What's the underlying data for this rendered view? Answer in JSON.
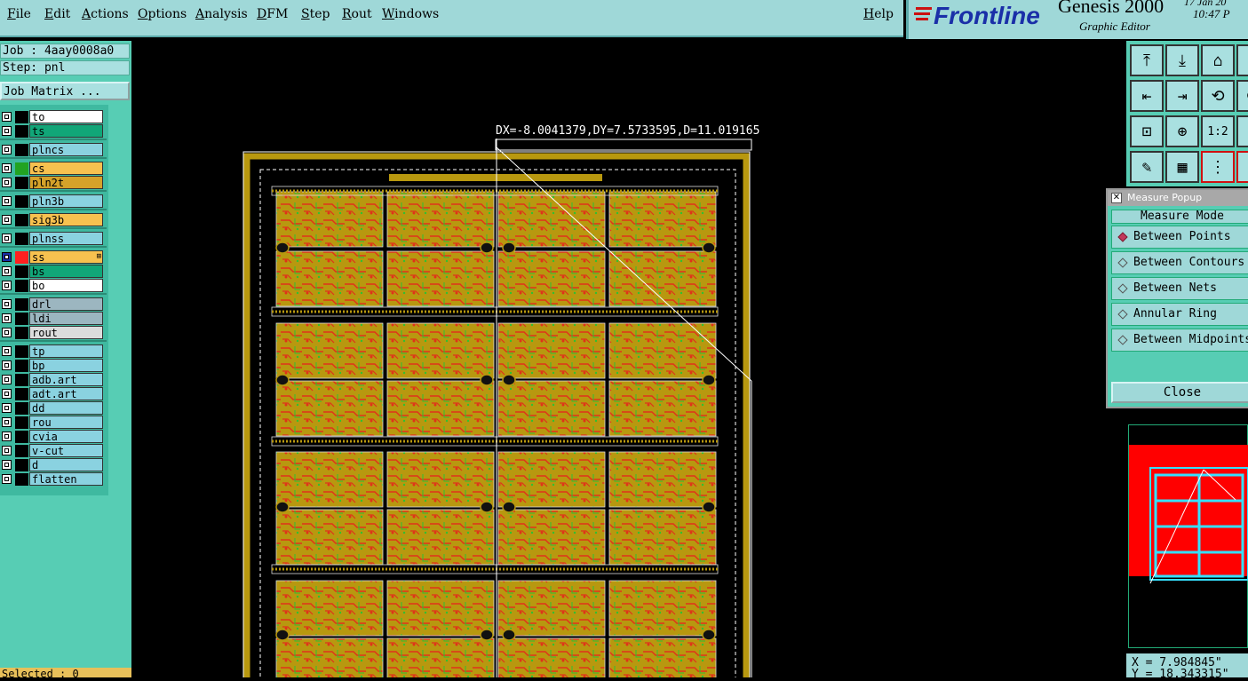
{
  "menu": {
    "items": [
      "File",
      "Edit",
      "Actions",
      "Options",
      "Analysis",
      "DFM",
      "Step",
      "Rout",
      "Windows"
    ],
    "help": "Help"
  },
  "brand": {
    "logo": "Frontline",
    "product": "Genesis 2000",
    "module": "Graphic Editor",
    "date": "17 Jan 20",
    "time": "10:47 P"
  },
  "job": {
    "job_label": "Job : 4aay0008a0",
    "step_label": "Step: pnl",
    "matrix_button": "Job Matrix ..."
  },
  "layers": [
    {
      "name": "to",
      "bg": "#ffffff",
      "swatch": "#000000"
    },
    {
      "name": "ts",
      "bg": "#11a678",
      "swatch": "#000000"
    },
    {
      "name": "plncs",
      "bg": "#8ad2e0",
      "swatch": "#000000"
    },
    {
      "name": "cs",
      "bg": "#f7c14f",
      "swatch": "#22a322"
    },
    {
      "name": "pln2t",
      "bg": "#d5a22a",
      "swatch": "#000000"
    },
    {
      "name": "pln3b",
      "bg": "#8ad2e0",
      "swatch": "#000000"
    },
    {
      "name": "sig3b",
      "bg": "#f7c14f",
      "swatch": "#000000"
    },
    {
      "name": "plnss",
      "bg": "#8ad2e0",
      "swatch": "#000000"
    },
    {
      "name": "ss",
      "bg": "#f7c14f",
      "swatch": "#ff2020",
      "active": true
    },
    {
      "name": "bs",
      "bg": "#11a678",
      "swatch": "#000000"
    },
    {
      "name": "bo",
      "bg": "#ffffff",
      "swatch": "#000000"
    },
    {
      "name": "drl",
      "bg": "#9cb6c0",
      "swatch": "#000000"
    },
    {
      "name": "ldi",
      "bg": "#9cb6c0",
      "swatch": "#000000"
    },
    {
      "name": "rout",
      "bg": "#dcdcdc",
      "swatch": "#000000"
    },
    {
      "name": "tp",
      "bg": "#8ad2e0",
      "swatch": "#000000"
    },
    {
      "name": "bp",
      "bg": "#8ad2e0",
      "swatch": "#000000"
    },
    {
      "name": "adb.art",
      "bg": "#8ad2e0",
      "swatch": "#000000"
    },
    {
      "name": "adt.art",
      "bg": "#8ad2e0",
      "swatch": "#000000"
    },
    {
      "name": "dd",
      "bg": "#8ad2e0",
      "swatch": "#000000"
    },
    {
      "name": "rou",
      "bg": "#8ad2e0",
      "swatch": "#000000"
    },
    {
      "name": "cvia",
      "bg": "#8ad2e0",
      "swatch": "#000000"
    },
    {
      "name": "v-cut",
      "bg": "#8ad2e0",
      "swatch": "#000000"
    },
    {
      "name": "d",
      "bg": "#8ad2e0",
      "swatch": "#000000"
    },
    {
      "name": "flatten",
      "bg": "#8ad2e0",
      "swatch": "#000000"
    }
  ],
  "selected_label": "Selected : 0",
  "measure_readout": "DX=-8.0041379,DY=7.5733595,D=11.019165",
  "tools": [
    {
      "icon": "home-top-icon"
    },
    {
      "icon": "home-bottom-icon"
    },
    {
      "icon": "house-icon"
    },
    {
      "icon": "side-icon"
    },
    {
      "icon": "pan-left-icon"
    },
    {
      "icon": "pan-right-icon"
    },
    {
      "icon": "step-left-icon"
    },
    {
      "icon": "step-right-icon"
    },
    {
      "icon": "zoom-fit-icon"
    },
    {
      "icon": "zoom-center-icon"
    },
    {
      "icon": "scale-icon",
      "label": "1:2"
    },
    {
      "icon": "panel-icon"
    },
    {
      "icon": "edit-tool-icon"
    },
    {
      "icon": "grid-icon"
    },
    {
      "icon": "net-icon"
    },
    {
      "icon": "net2-icon"
    }
  ],
  "popup": {
    "title": "Measure Popup",
    "heading": "Measure Mode",
    "options": [
      "Between Points",
      "Between Contours",
      "Between Nets",
      "Annular Ring",
      "Between Midpoints"
    ],
    "selected_index": 0,
    "close": "Close"
  },
  "coords": {
    "x": "X = 7.984845\"",
    "y": "Y = 18.343315\""
  },
  "colors": {
    "panel_teal": "#57cdb4",
    "menu_bg": "#9fd8d8",
    "board_gold": "#b8980f",
    "trace_red": "#e0321a",
    "preview_red": "#ff0000"
  }
}
